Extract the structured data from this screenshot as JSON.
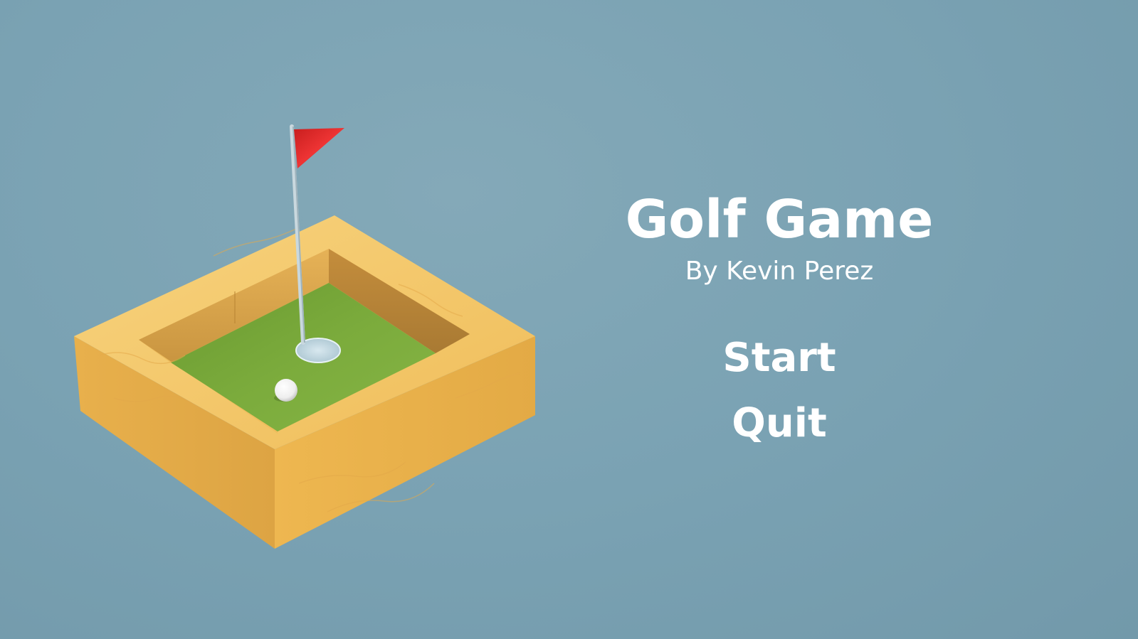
{
  "menu": {
    "title": "Golf Game",
    "subtitle": "By Kevin Perez",
    "start_label": "Start",
    "quit_label": "Quit"
  },
  "scene": {
    "flag_icon": "golf-flag-icon",
    "ball_icon": "golf-ball-icon"
  },
  "colors": {
    "background": "#7aa2b3",
    "wood": "#f0be5c",
    "grass": "#79a93a",
    "flag": "#e02a2a",
    "text": "#ffffff"
  }
}
